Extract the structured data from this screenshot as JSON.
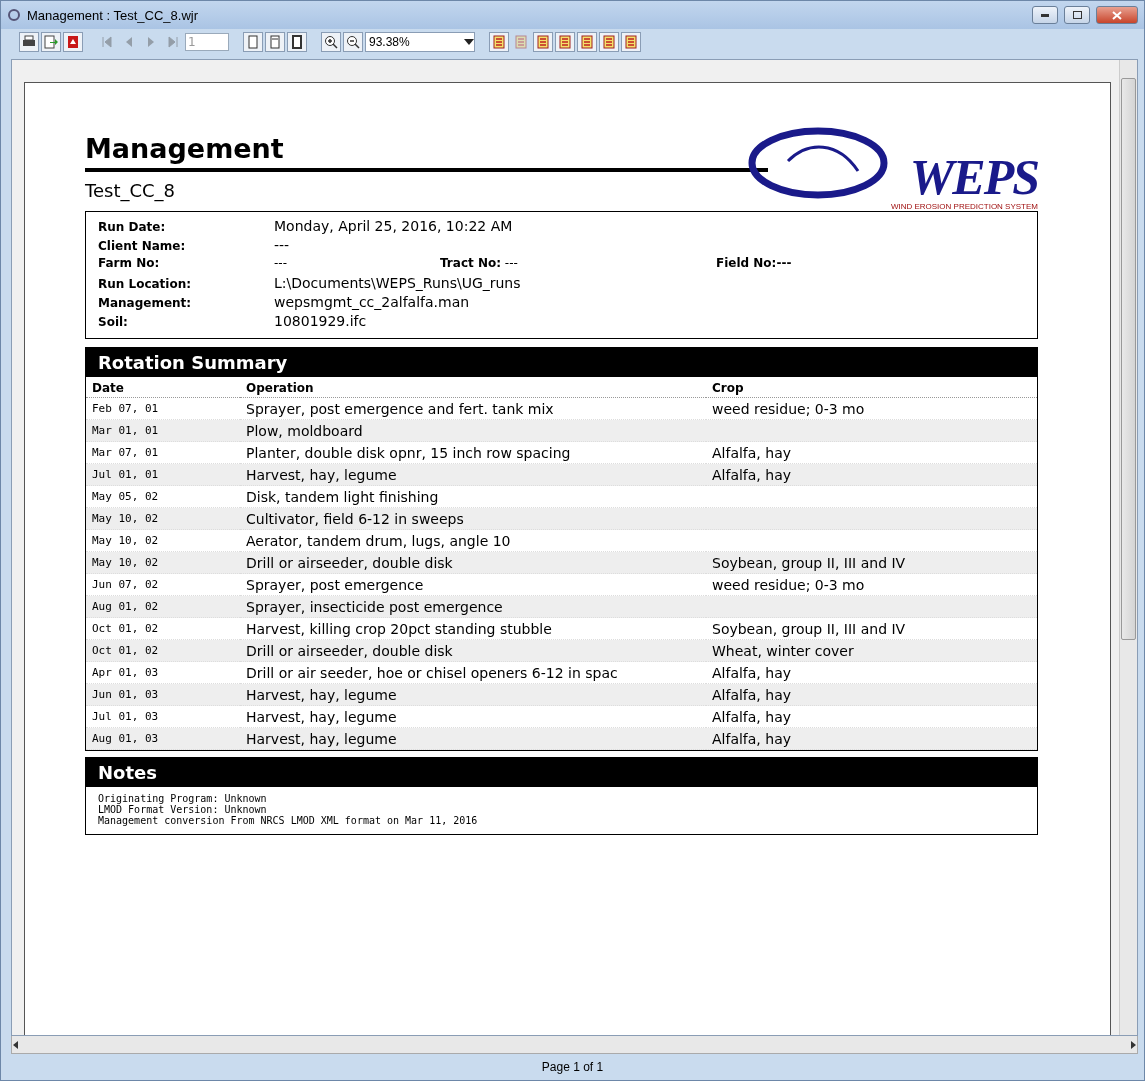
{
  "window": {
    "title": "Management : Test_CC_8.wjr"
  },
  "toolbar": [
    {
      "kind": "print",
      "disabled": false
    },
    {
      "kind": "export",
      "disabled": false
    },
    {
      "kind": "pdf",
      "disabled": false
    },
    {
      "kind": "sep"
    },
    {
      "kind": "first",
      "disabled": true
    },
    {
      "kind": "prev",
      "disabled": true
    },
    {
      "kind": "next",
      "disabled": true
    },
    {
      "kind": "last",
      "disabled": true
    },
    {
      "kind": "page-field",
      "value": "1"
    },
    {
      "kind": "sep"
    },
    {
      "kind": "page-single",
      "disabled": false
    },
    {
      "kind": "page-width",
      "disabled": false
    },
    {
      "kind": "page-full",
      "disabled": false
    },
    {
      "kind": "sep"
    },
    {
      "kind": "zoom-in",
      "disabled": false
    },
    {
      "kind": "zoom-out",
      "disabled": false
    },
    {
      "kind": "zoom-field",
      "value": "93.38%"
    },
    {
      "kind": "sep"
    },
    {
      "kind": "report",
      "disabled": false
    },
    {
      "kind": "report",
      "disabled": true
    },
    {
      "kind": "report",
      "disabled": false
    },
    {
      "kind": "report",
      "disabled": false
    },
    {
      "kind": "report",
      "disabled": false
    },
    {
      "kind": "report",
      "disabled": false
    },
    {
      "kind": "report",
      "disabled": false
    }
  ],
  "report": {
    "title": "Management",
    "subtitle": "Test_CC_8",
    "logo_text": "WEPS",
    "logo_tagline": "WIND EROSION PREDICTION SYSTEM",
    "info": [
      {
        "label": "Run Date:",
        "value": "Monday, April 25, 2016, 10:22 AM"
      },
      {
        "label": "Client Name:",
        "value": "---"
      },
      {
        "label": "Farm No:",
        "value": "---",
        "tract_label": "Tract No:",
        "tract_value": "---",
        "field_text": "Field No:---"
      },
      {
        "label": "Run Location:",
        "value": "L:\\Documents\\WEPS_Runs\\UG_runs"
      },
      {
        "label": "Management:",
        "value": "wepsmgmt_cc_2alfalfa.man"
      },
      {
        "label": "Soil:",
        "value": "10801929.ifc"
      }
    ],
    "rotation": {
      "title": "Rotation Summary",
      "columns": [
        "Date",
        "Operation",
        "Crop"
      ],
      "rows": [
        {
          "date": "Feb 07, 01",
          "operation": "Sprayer, post emergence and fert. tank mix",
          "crop": "weed residue; 0-3 mo"
        },
        {
          "date": "Mar 01, 01",
          "operation": "Plow, moldboard"
        },
        {
          "date": "Mar 07, 01",
          "operation": "Planter, double disk opnr, 15 inch row spacing",
          "crop": "Alfalfa, hay"
        },
        {
          "date": "Jul 01, 01",
          "operation": "Harvest, hay, legume",
          "crop": "Alfalfa, hay"
        },
        {
          "date": "May 05, 02",
          "operation": "Disk, tandem light finishing"
        },
        {
          "date": "May 10, 02",
          "operation": "Cultivator, field 6-12 in sweeps"
        },
        {
          "date": "May 10, 02",
          "operation": "Aerator, tandem drum, lugs, angle 10"
        },
        {
          "date": "May 10, 02",
          "operation": "Drill or airseeder, double disk",
          "crop": "Soybean, group II, III and IV"
        },
        {
          "date": "Jun 07, 02",
          "operation": "Sprayer, post emergence",
          "crop": "weed residue; 0-3 mo"
        },
        {
          "date": "Aug 01, 02",
          "operation": "Sprayer, insecticide post emergence"
        },
        {
          "date": "Oct 01, 02",
          "operation": "Harvest, killing crop 20pct standing stubble",
          "crop": "Soybean, group II, III and IV"
        },
        {
          "date": "Oct 01, 02",
          "operation": "Drill or airseeder, double disk",
          "crop": "Wheat, winter cover"
        },
        {
          "date": "Apr 01, 03",
          "operation": "Drill or air seeder, hoe or chisel openers 6-12 in spac",
          "crop": "Alfalfa, hay"
        },
        {
          "date": "Jun 01, 03",
          "operation": "Harvest, hay, legume",
          "crop": "Alfalfa, hay"
        },
        {
          "date": "Jul 01, 03",
          "operation": "Harvest, hay, legume",
          "crop": "Alfalfa, hay"
        },
        {
          "date": "Aug 01, 03",
          "operation": "Harvest, hay, legume",
          "crop": "Alfalfa, hay"
        }
      ]
    },
    "notes": {
      "title": "Notes",
      "lines": [
        "Originating Program: Unknown",
        "LMOD Format Version: Unknown",
        "Management conversion From NRCS LMOD XML format on Mar 11, 2016"
      ]
    }
  },
  "status_bar": {
    "page": "Page 1 of 1"
  }
}
